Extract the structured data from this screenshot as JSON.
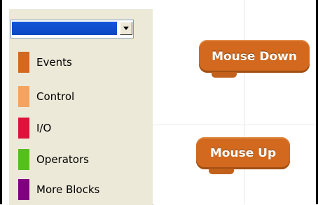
{
  "palette": {
    "dropdown": {
      "selected_value": "",
      "arrow_icon": "chevron-down-icon"
    },
    "categories": [
      {
        "label": "Events",
        "color": "#d2691e"
      },
      {
        "label": "Control",
        "color": "#f4a460"
      },
      {
        "label": "I/O",
        "color": "#dc143c"
      },
      {
        "label": "Operators",
        "color": "#55c01d"
      },
      {
        "label": "More Blocks",
        "color": "#800080"
      }
    ]
  },
  "scripts": {
    "blocks": [
      {
        "label": "Mouse Down",
        "color": "#d2691e"
      },
      {
        "label": "Mouse Up",
        "color": "#d2691e"
      }
    ]
  }
}
